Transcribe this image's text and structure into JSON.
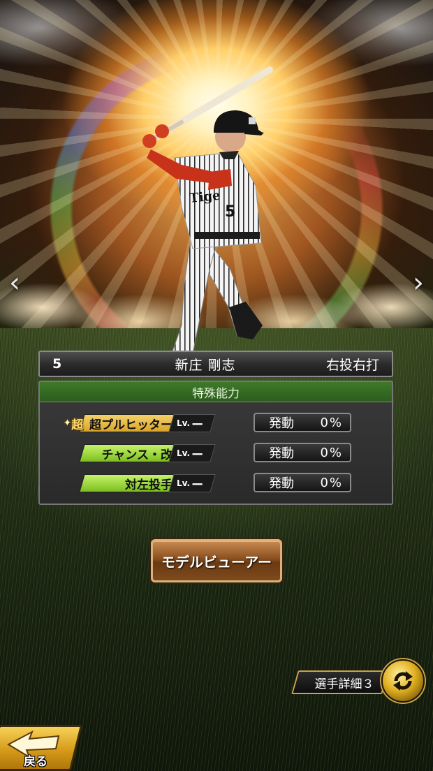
{
  "player": {
    "number": "5",
    "name": "新庄 剛志",
    "handedness": "右投右打"
  },
  "abilities": {
    "header": "特殊能力",
    "items": [
      {
        "super_mark": "超",
        "name": "超プルヒッター",
        "level_label": "Lv.",
        "level_value": "ー",
        "trigger_label": "発動",
        "trigger_value": "0%",
        "color": "#e8b93c"
      },
      {
        "name": "チャンス・改",
        "level_label": "Lv.",
        "level_value": "ー",
        "trigger_label": "発動",
        "trigger_value": "0%",
        "color": "#9fdc3e"
      },
      {
        "name": "対左投手",
        "level_label": "Lv.",
        "level_value": "ー",
        "trigger_label": "発動",
        "trigger_value": "0%",
        "color": "#9fdc3e"
      }
    ]
  },
  "buttons": {
    "model_viewer": "モデルビューアー",
    "player_detail": "選手詳細３",
    "back": "戻る"
  },
  "icons": {
    "prev": "chevron-left-icon",
    "next": "chevron-right-icon",
    "swap": "swap-arrows-icon",
    "back": "back-arrow-icon"
  }
}
